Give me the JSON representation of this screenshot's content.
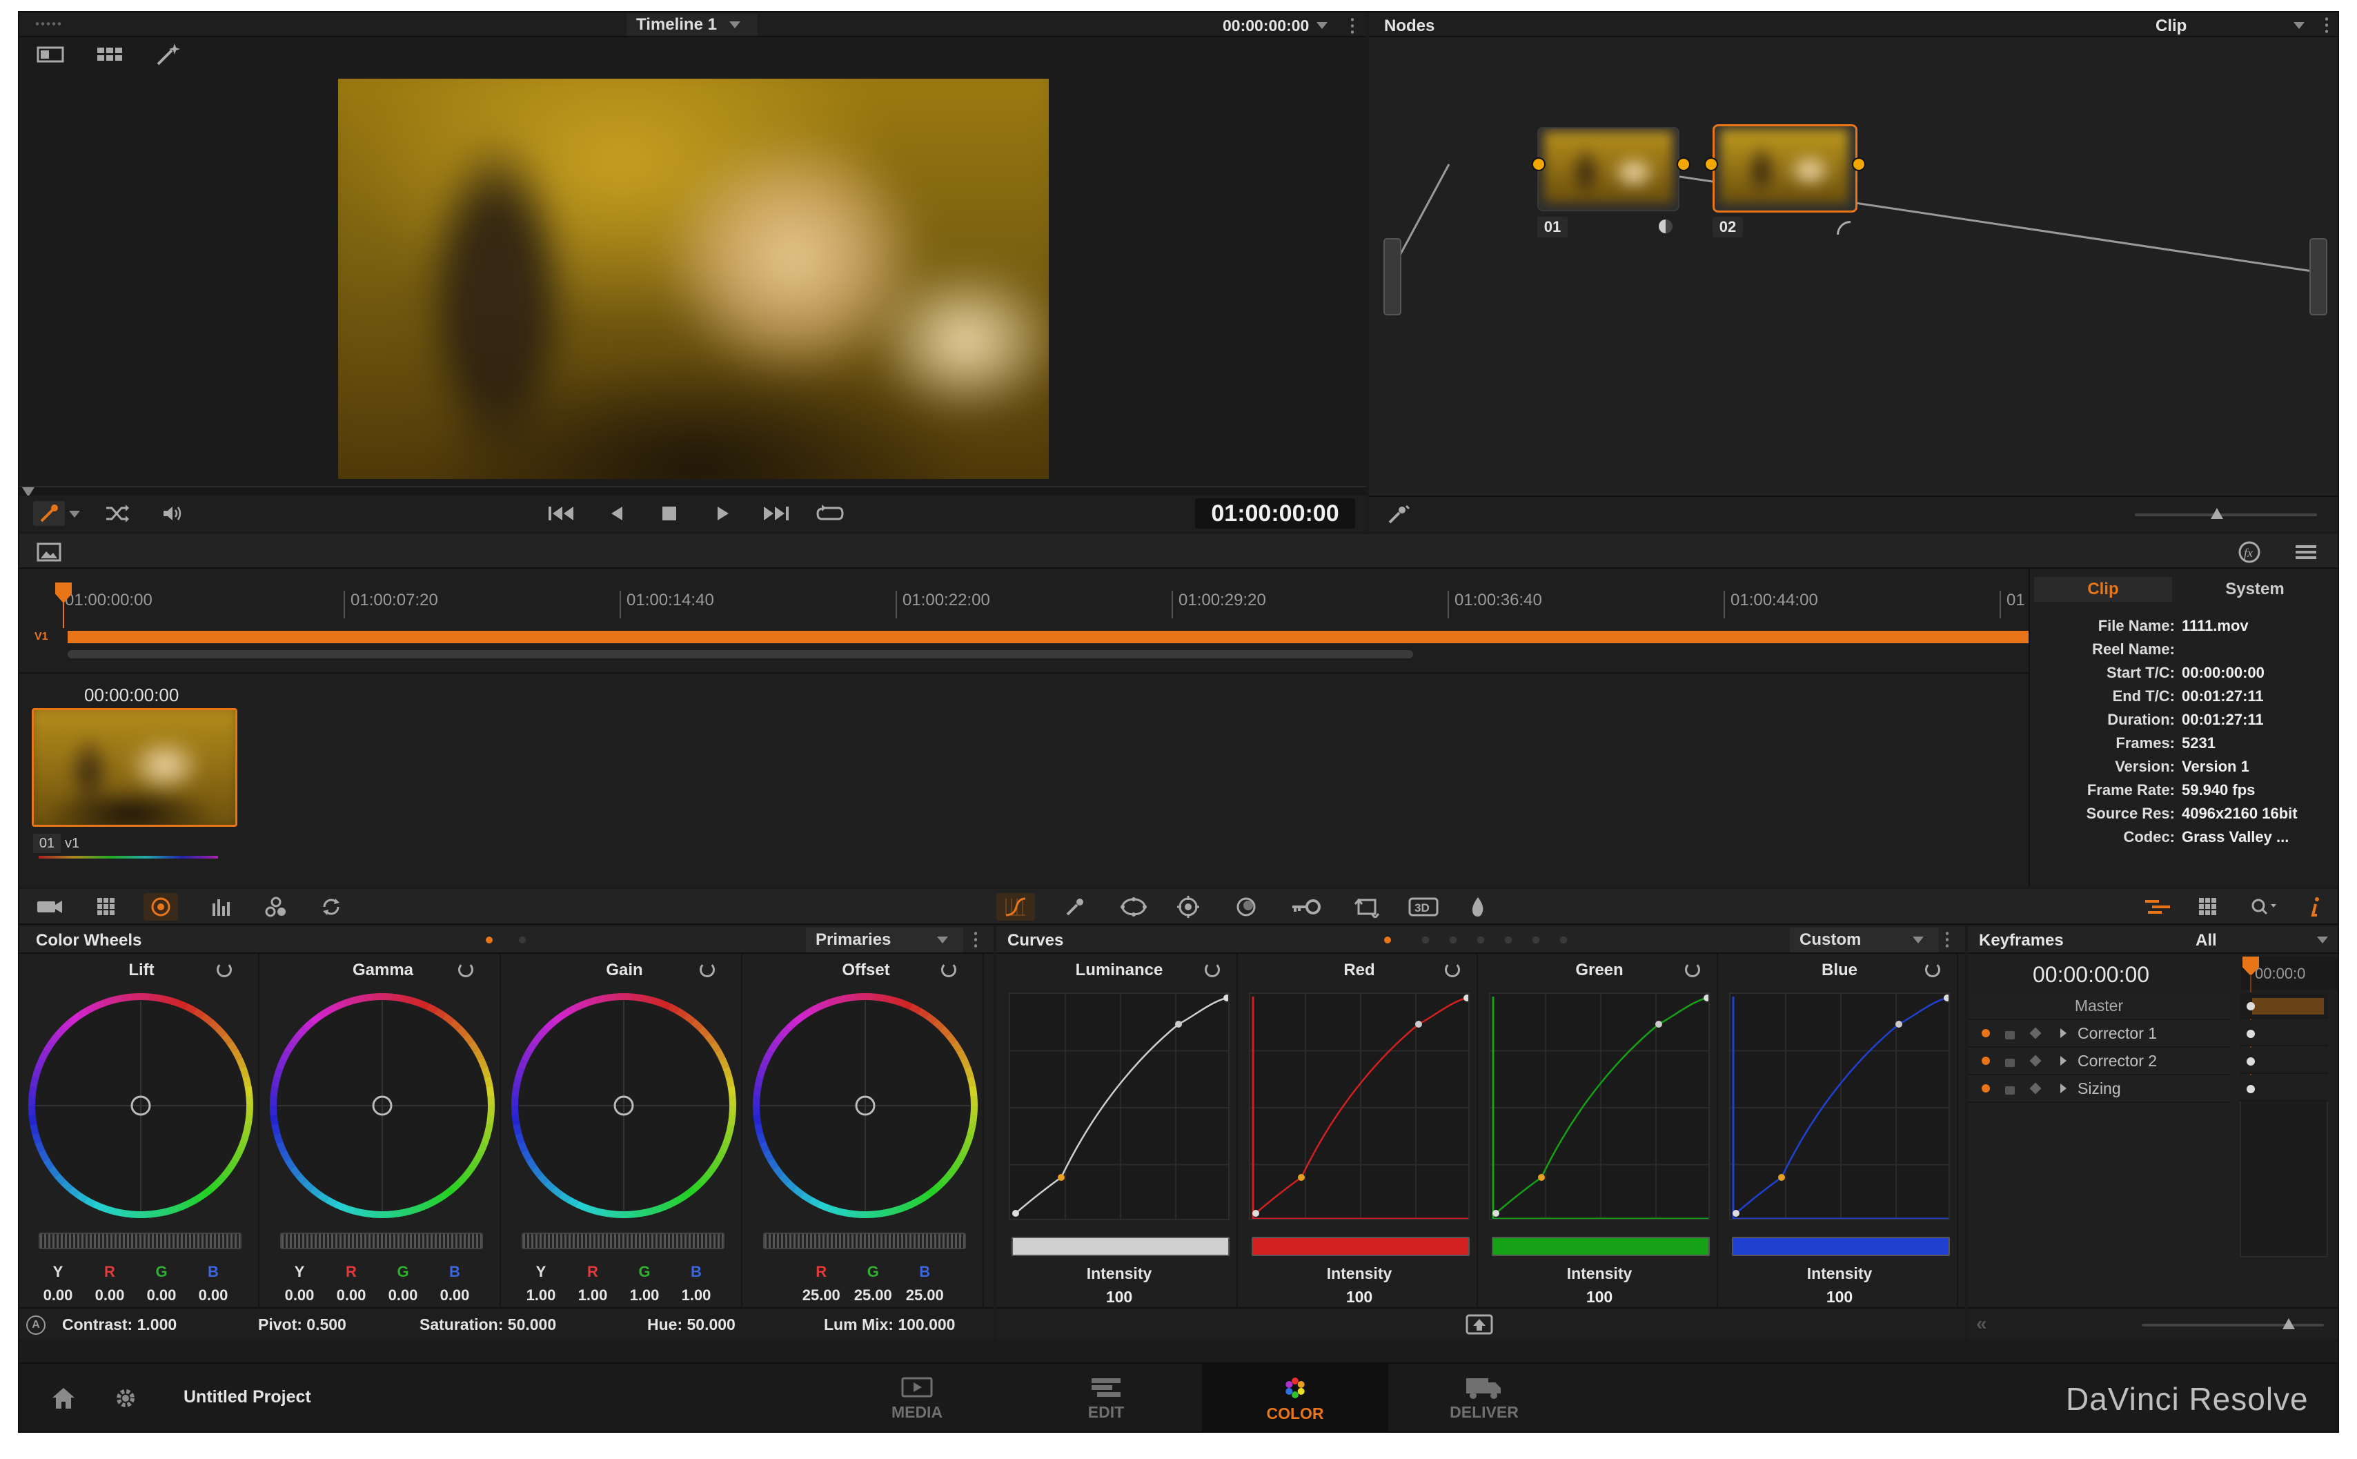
{
  "viewer": {
    "timeline_label": "Timeline 1",
    "timecode": "00:00:00:00",
    "playhead_timecode": "01:00:00:00"
  },
  "nodes": {
    "title": "Nodes",
    "mode": "Clip",
    "node1_label": "01",
    "node2_label": "02"
  },
  "timeline": {
    "ticks": [
      "01:00:00:00",
      "01:00:07:20",
      "01:00:14:40",
      "01:00:22:00",
      "01:00:29:20",
      "01:00:36:40",
      "01:00:44:00",
      "01"
    ],
    "track_label": "V1",
    "thumb_timecode": "00:00:00:00",
    "thumb_clip": "01",
    "thumb_track": "v1"
  },
  "info": {
    "tab_clip": "Clip",
    "tab_system": "System",
    "rows": [
      {
        "k": "File Name:",
        "v": "1111.mov"
      },
      {
        "k": "Reel Name:",
        "v": ""
      },
      {
        "k": "Start T/C:",
        "v": "00:00:00:00"
      },
      {
        "k": "End T/C:",
        "v": "00:01:27:11"
      },
      {
        "k": "Duration:",
        "v": "00:01:27:11"
      },
      {
        "k": "Frames:",
        "v": "5231"
      },
      {
        "k": "Version:",
        "v": "Version 1"
      },
      {
        "k": "Frame Rate:",
        "v": "59.940 fps"
      },
      {
        "k": "Source Res:",
        "v": "4096x2160 16bit"
      },
      {
        "k": "Codec:",
        "v": "Grass Valley ..."
      }
    ]
  },
  "wheels": {
    "title": "Color Wheels",
    "mode": "Primaries",
    "items": [
      {
        "name": "Lift",
        "labels": [
          "Y",
          "R",
          "G",
          "B"
        ],
        "values": [
          "0.00",
          "0.00",
          "0.00",
          "0.00"
        ]
      },
      {
        "name": "Gamma",
        "labels": [
          "Y",
          "R",
          "G",
          "B"
        ],
        "values": [
          "0.00",
          "0.00",
          "0.00",
          "0.00"
        ]
      },
      {
        "name": "Gain",
        "labels": [
          "Y",
          "R",
          "G",
          "B"
        ],
        "values": [
          "1.00",
          "1.00",
          "1.00",
          "1.00"
        ]
      },
      {
        "name": "Offset",
        "labels": [
          "R",
          "G",
          "B"
        ],
        "values": [
          "25.00",
          "25.00",
          "25.00"
        ]
      }
    ],
    "footer": {
      "contrast": "Contrast: 1.000",
      "pivot": "Pivot: 0.500",
      "saturation": "Saturation: 50.000",
      "hue": "Hue: 50.000",
      "lum_mix": "Lum Mix: 100.000"
    }
  },
  "curves": {
    "title": "Curves",
    "mode": "Custom",
    "channels": [
      {
        "name": "Luminance",
        "color": "#cfcfcf",
        "intensity_label": "Intensity",
        "intensity": "100"
      },
      {
        "name": "Red",
        "color": "#d22020",
        "intensity_label": "Intensity",
        "intensity": "100"
      },
      {
        "name": "Green",
        "color": "#15a015",
        "intensity_label": "Intensity",
        "intensity": "100"
      },
      {
        "name": "Blue",
        "color": "#2040d0",
        "intensity_label": "Intensity",
        "intensity": "100"
      }
    ]
  },
  "keyframes": {
    "title": "Keyframes",
    "filter": "All",
    "timecode": "00:00:00:00",
    "ruler_tc": "00:00:0",
    "rows": [
      "Master",
      "Corrector 1",
      "Corrector 2",
      "Sizing"
    ]
  },
  "bottom": {
    "project": "Untitled Project",
    "pages": [
      "MEDIA",
      "EDIT",
      "COLOR",
      "DELIVER"
    ],
    "brand": "DaVinci Resolve"
  },
  "colors": {
    "accent": "#e87619",
    "panel": "#1f1f20",
    "active_page": "#e87619"
  }
}
